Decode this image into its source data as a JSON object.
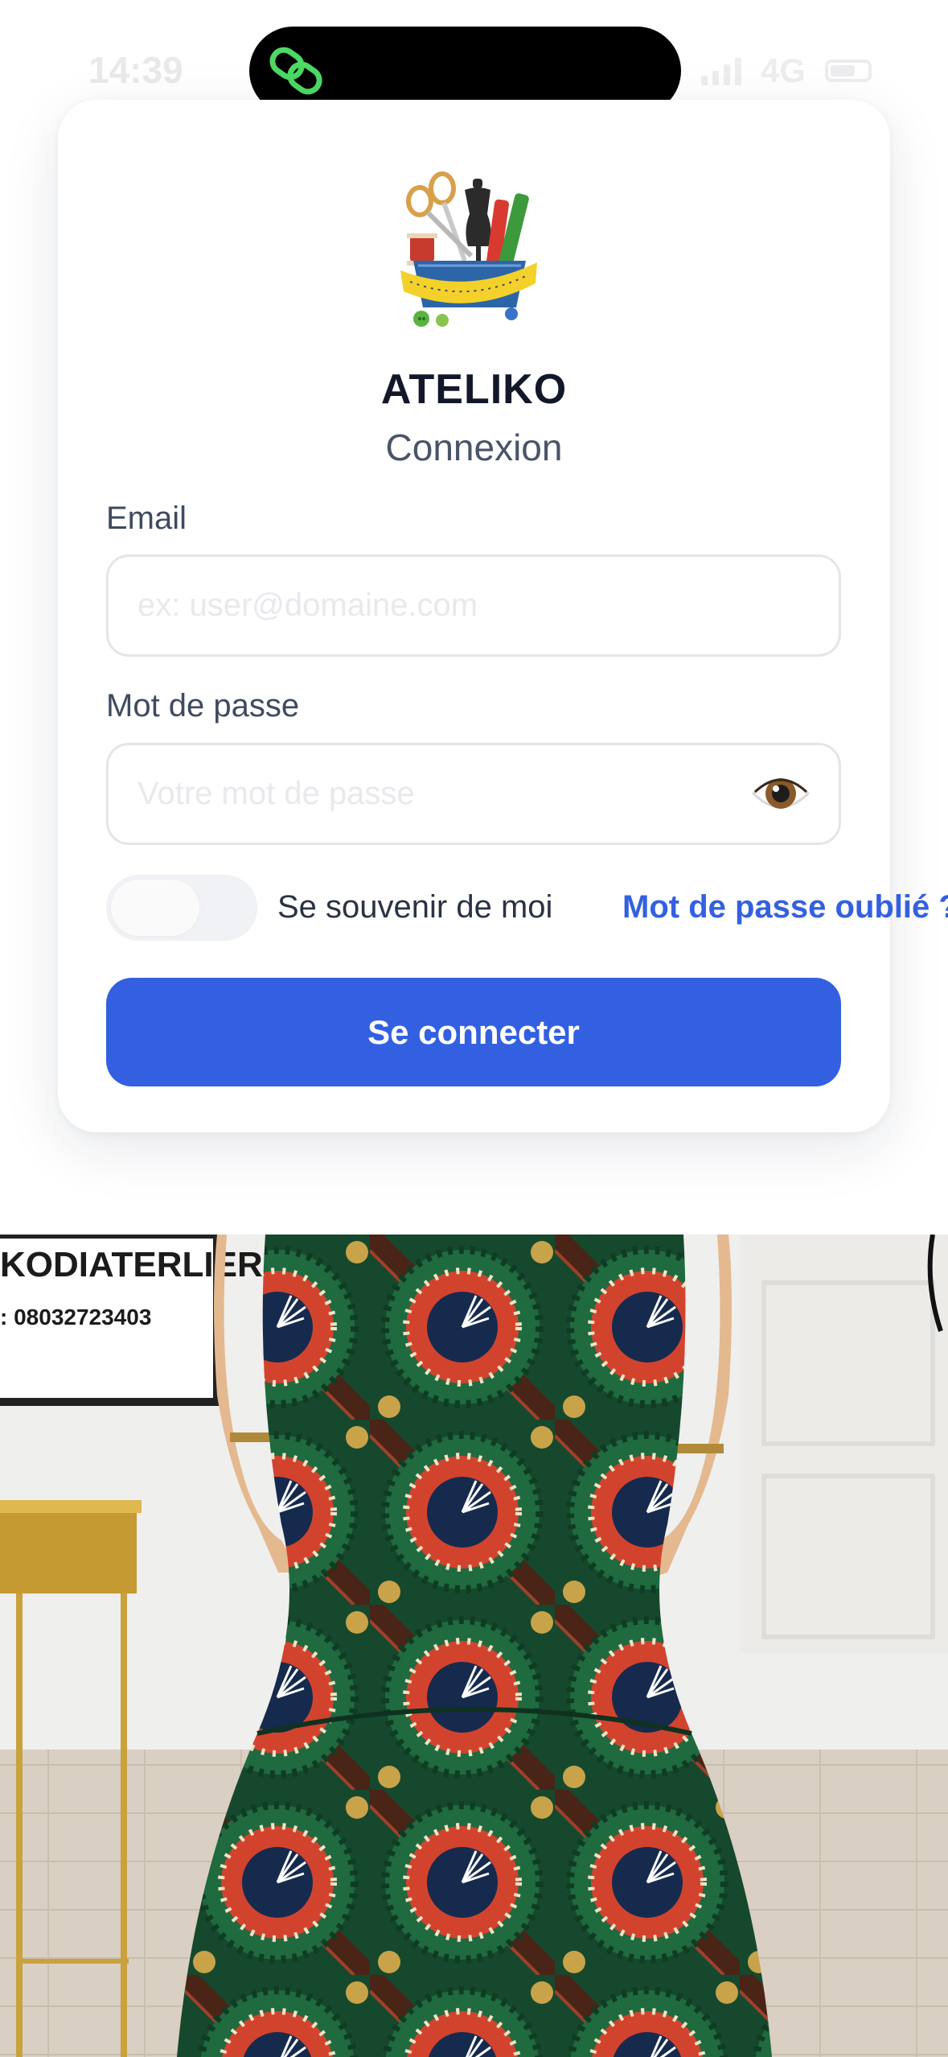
{
  "status_bar": {
    "time": "14:39",
    "network": "4G"
  },
  "app": {
    "name": "ATELIKO",
    "subtitle": "Connexion"
  },
  "form": {
    "email_label": "Email",
    "email_placeholder": "ex: user@domaine.com",
    "email_value": "",
    "password_label": "Mot de passe",
    "password_placeholder": "Votre mot de passe",
    "password_value": "",
    "show_password_icon": "eye-icon",
    "remember_label": "Se souvenir de moi",
    "remember_checked": false,
    "forgot_label": "Mot de passe oublié ?",
    "submit_label": "Se connecter"
  },
  "photo": {
    "sign_line1": "KODIATERLIERS",
    "sign_line2": ": 08032723403"
  },
  "colors": {
    "primary": "#3360e0",
    "title": "#121829",
    "text": "#3f4a5e",
    "island_icon": "#4cd964"
  }
}
